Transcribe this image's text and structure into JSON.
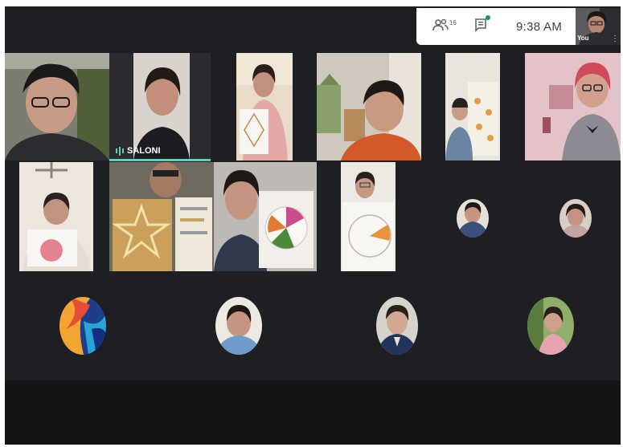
{
  "meeting": {
    "participant_count": "16",
    "clock": "9:38 AM",
    "self_label": "You",
    "active_speaker_name": "SALONI"
  },
  "icons": {
    "people": "people-icon",
    "chat": "chat-icon",
    "mic_active": "audio-level-icon",
    "more": "more-options-icon"
  },
  "colors": {
    "stage_bg": "#1e1f22",
    "speaking_accent": "#5fd0c0",
    "chat_dot": "#1a8f6f"
  }
}
